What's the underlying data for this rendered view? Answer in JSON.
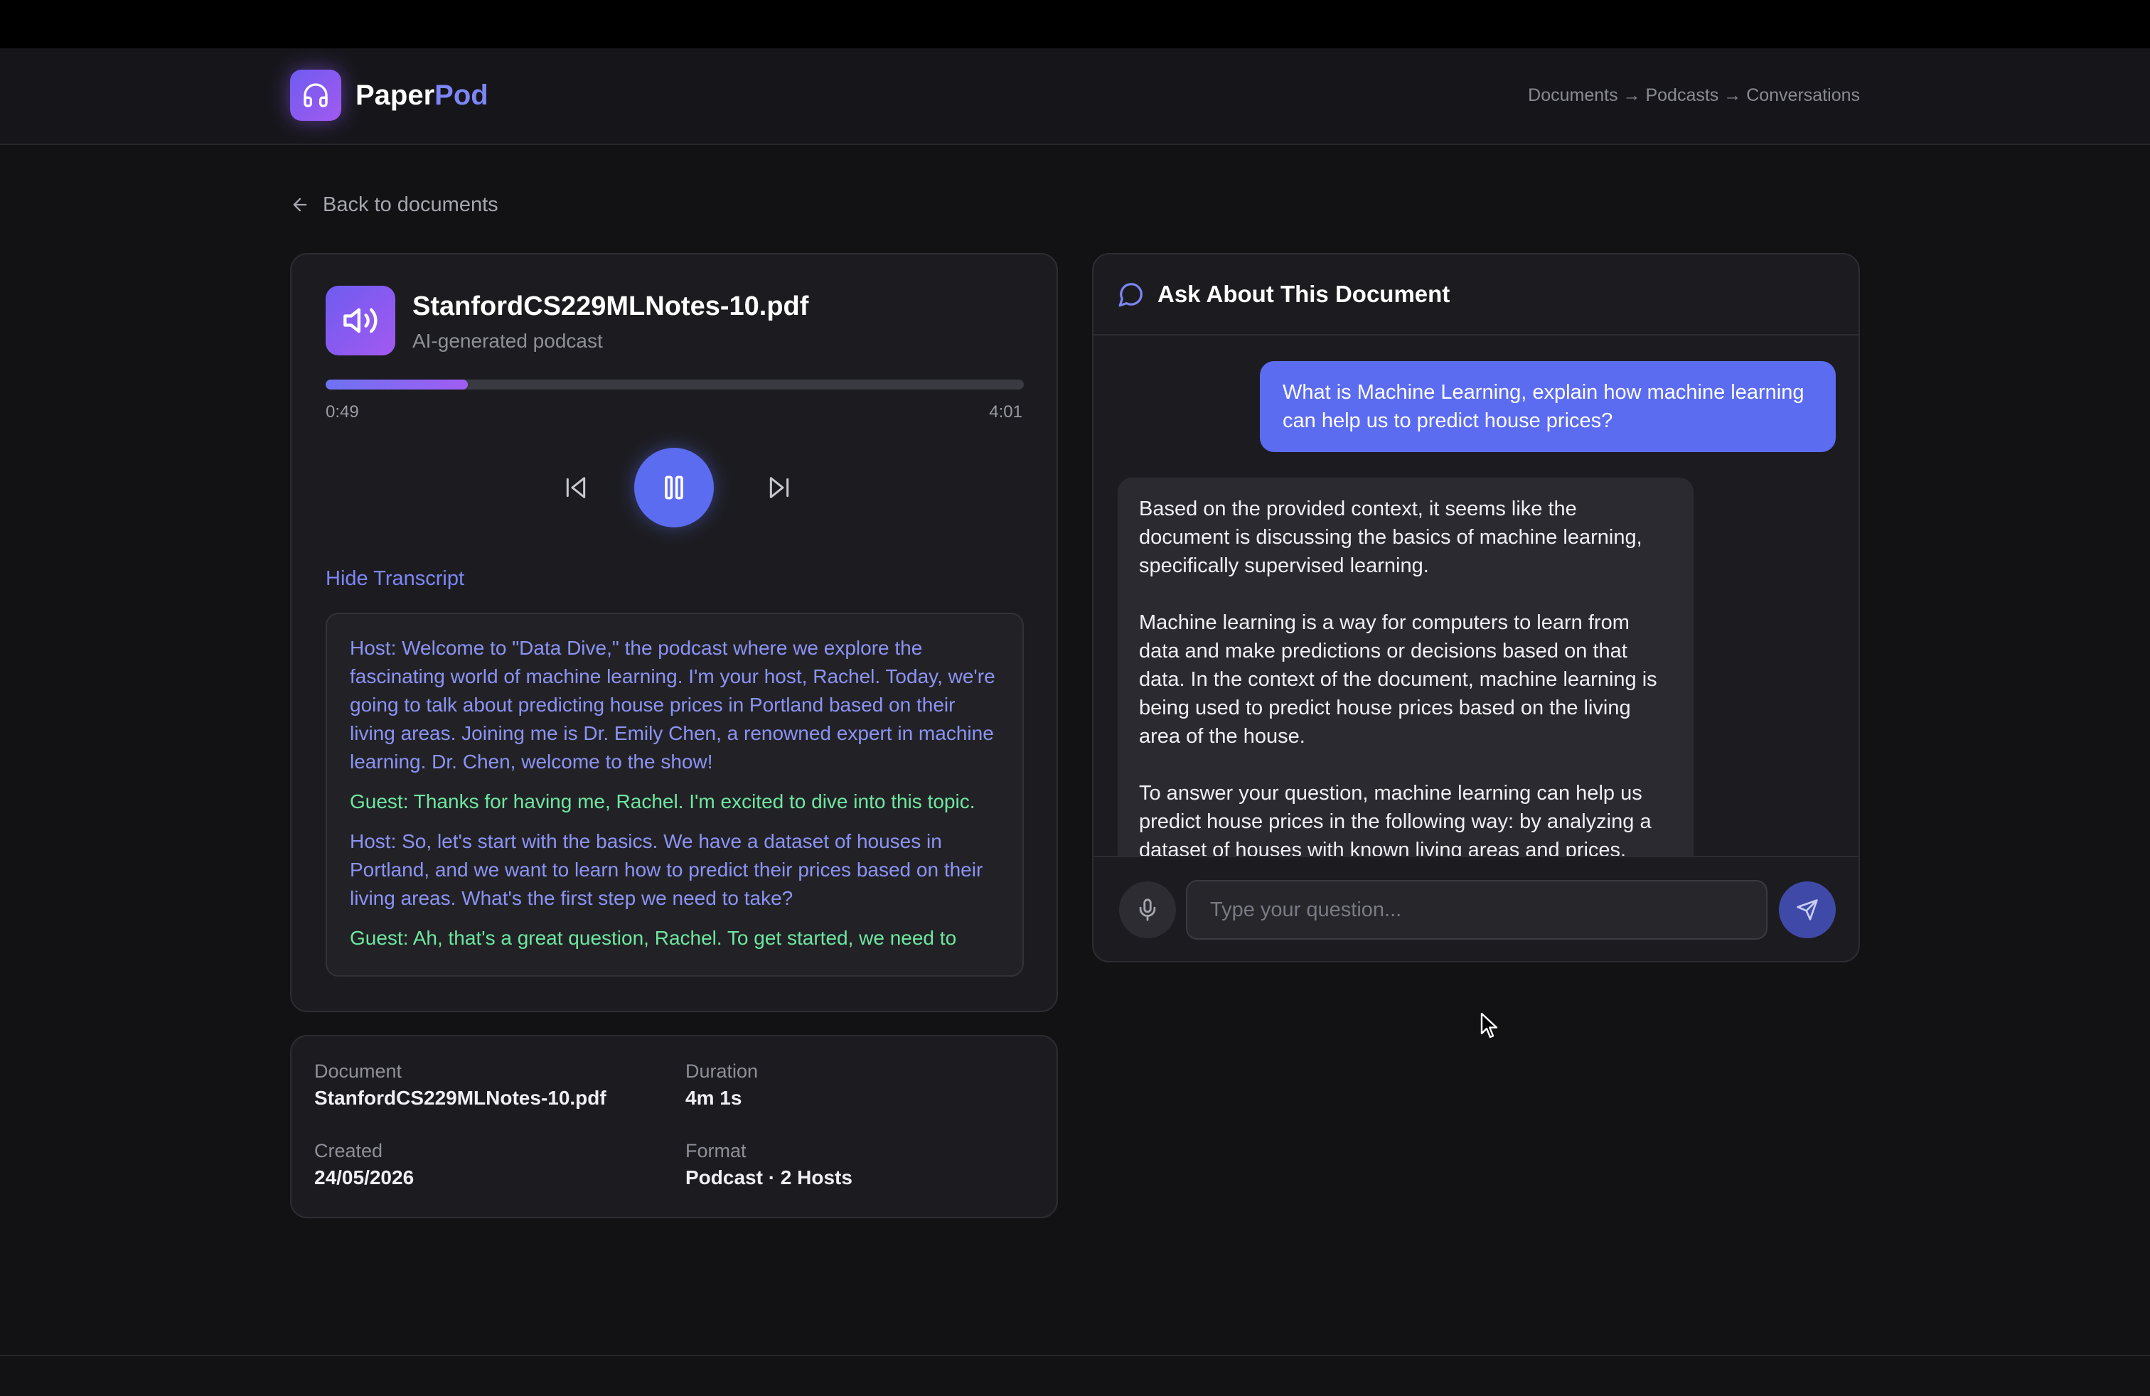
{
  "header": {
    "brand_part1": "Paper",
    "brand_part2": "Pod",
    "breadcrumb": "Documents → Podcasts → Conversations",
    "logo_icon": "headphones-icon"
  },
  "back_link": {
    "label": "Back to documents",
    "icon": "arrow-left-icon"
  },
  "player": {
    "file_name": "StanfordCS229MLNotes-10.pdf",
    "subtitle": "AI-generated podcast",
    "icon": "speaker-icon",
    "current_time": "0:49",
    "total_time": "4:01",
    "progress": 0.2033,
    "controls": {
      "prev": "skip-back-icon",
      "pause": "pause-icon",
      "next": "skip-forward-icon"
    },
    "transcript_toggle": "Hide Transcript",
    "transcript": [
      {
        "speaker": "host",
        "text": "Host: Welcome to \"Data Dive,\" the podcast where we explore the fascinating world of machine learning. I'm your host, Rachel. Today, we're going to talk about predicting house prices in Portland based on their living areas. Joining me is Dr. Emily Chen, a renowned expert in machine learning. Dr. Chen, welcome to the show!"
      },
      {
        "speaker": "guest",
        "text": "Guest: Thanks for having me, Rachel. I'm excited to dive into this topic."
      },
      {
        "speaker": "host",
        "text": "Host: So, let's start with the basics. We have a dataset of houses in Portland, and we want to learn how to predict their prices based on their living areas. What's the first step we need to take?"
      },
      {
        "speaker": "guest",
        "text": "Guest: Ah, that's a great question, Rachel. To get started, we need to"
      }
    ]
  },
  "info": {
    "document_label": "Document",
    "document_value": "StanfordCS229MLNotes-10.pdf",
    "duration_label": "Duration",
    "duration_value": "4m 1s",
    "created_label": "Created",
    "created_value": "24/05/2026",
    "format_label": "Format",
    "format_value": "Podcast · 2 Hosts"
  },
  "chat": {
    "title": "Ask About This Document",
    "icon": "chat-bubble-icon",
    "user_message": "What is Machine Learning, explain how machine learning can help us to predict house prices?",
    "bot_paragraphs": [
      "Based on the provided context, it seems like the document is discussing the basics of machine learning, specifically supervised learning.",
      "Machine learning is a way for computers to learn from data and make predictions or decisions based on that data. In the context of the document, machine learning is being used to predict house prices based on the living area of the house.",
      "To answer your question, machine learning can help us predict house prices in the following way: by analyzing a dataset of houses with known living areas and prices,"
    ],
    "input_placeholder": "Type your question...",
    "input_value": "",
    "mic_icon": "microphone-icon",
    "send_icon": "send-icon"
  },
  "colors": {
    "accent": "#5b6cf0",
    "accent_purple": "#a259f0",
    "host_text": "#8c93f5",
    "guest_text": "#6ee7a0",
    "background": "#121214",
    "card": "#1c1c20"
  }
}
